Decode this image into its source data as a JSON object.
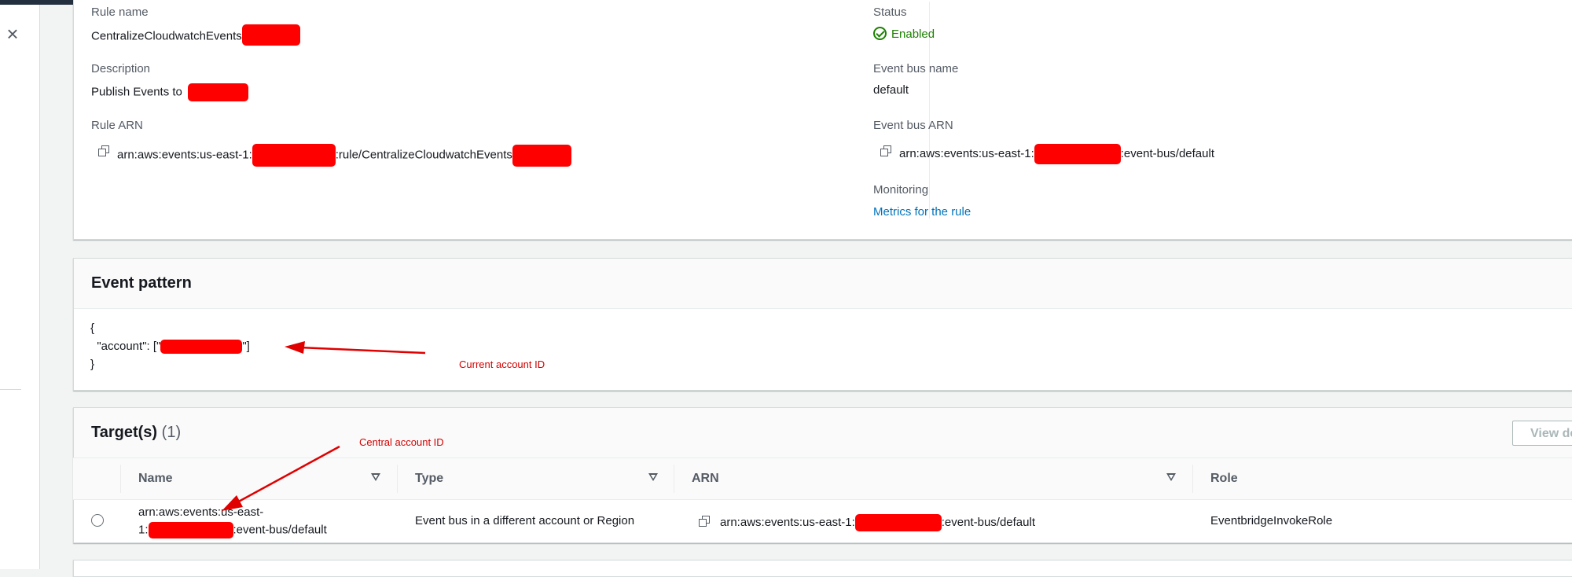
{
  "top_panel": {
    "rule_name_label": "Rule name",
    "rule_name_value": "CentralizeCloudwatchEvents",
    "description_label": "Description",
    "description_value": "Publish Events to",
    "rule_arn_label": "Rule ARN",
    "rule_arn_prefix": "arn:aws:events:us-east-1:",
    "rule_arn_middle": ":rule/CentralizeCloudwatchEvents",
    "status_label": "Status",
    "status_value": "Enabled",
    "event_bus_name_label": "Event bus name",
    "event_bus_name_value": "default",
    "event_bus_arn_label": "Event bus ARN",
    "event_bus_arn_prefix": "arn:aws:events:us-east-1:",
    "event_bus_arn_suffix": ":event-bus/default",
    "monitoring_label": "Monitoring",
    "monitoring_link": "Metrics for the rule"
  },
  "event_pattern": {
    "title": "Event pattern",
    "line1": "{",
    "line2_prefix": "  \"account\": [\"",
    "line2_suffix": "\"]",
    "line3": "}"
  },
  "targets": {
    "title": "Target(s)",
    "count": "(1)",
    "view_button": "View de",
    "columns": [
      "Name",
      "Type",
      "ARN",
      "Role"
    ],
    "row": {
      "name_line1": "arn:aws:events:us-east-",
      "name_line2_prefix": "1:",
      "name_line2_suffix": ":event-bus/default",
      "type": "Event bus in a different account or Region",
      "arn_prefix": "arn:aws:events:us-east-1:",
      "arn_suffix": ":event-bus/default",
      "role": "EventbridgeInvokeRole"
    }
  },
  "annotations": {
    "current_account": "Current account ID",
    "central_account": "Central account ID"
  },
  "colors": {
    "link": "#0073bb",
    "success": "#1d8102",
    "redaction": "#ff0000",
    "annotation": "#d40000"
  }
}
